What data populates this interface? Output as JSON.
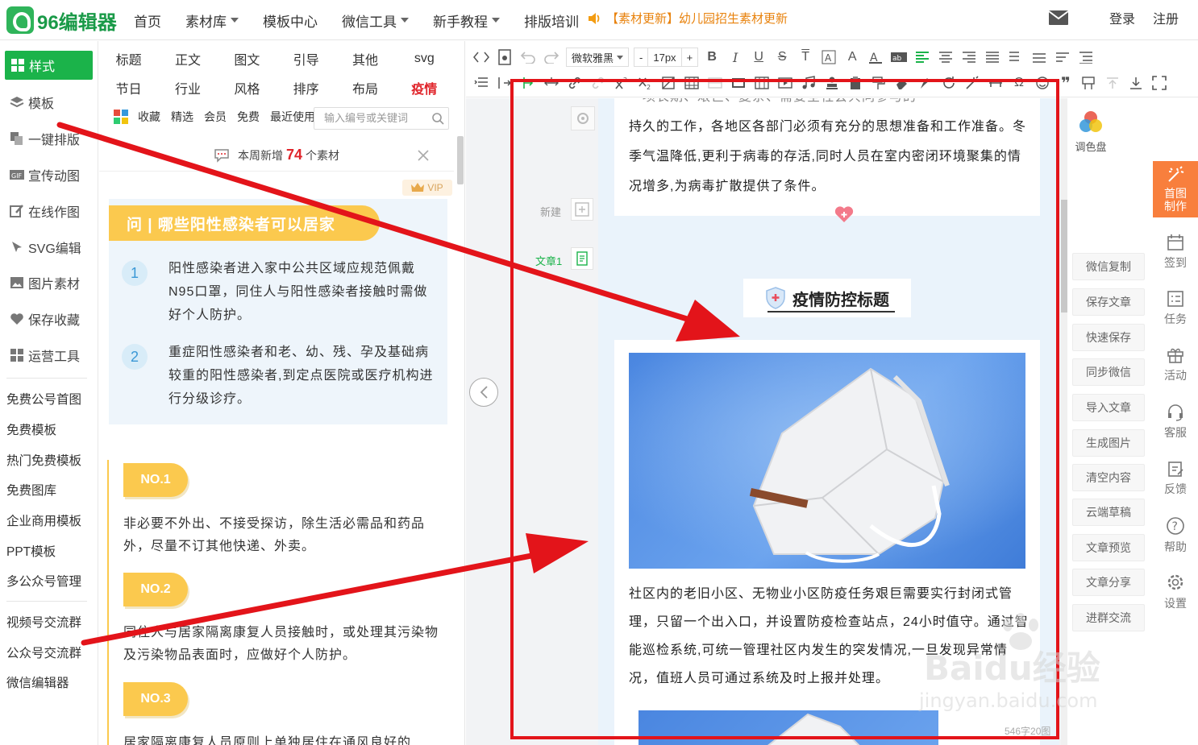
{
  "header": {
    "logo_text": "96编辑器",
    "nav": [
      {
        "label": "首页",
        "caret": false
      },
      {
        "label": "素材库",
        "caret": true
      },
      {
        "label": "模板中心",
        "caret": false
      },
      {
        "label": "微信工具",
        "caret": true
      },
      {
        "label": "新手教程",
        "caret": true
      },
      {
        "label": "排版培训",
        "caret": false
      }
    ],
    "notice": "【素材更新】幼儿园招生素材更新",
    "login": "登录",
    "register": "注册"
  },
  "sidebar": {
    "items": [
      "样式",
      "模板",
      "一键排版",
      "宣传动图",
      "在线作图",
      "SVG编辑",
      "图片素材",
      "保存收藏",
      "运营工具"
    ],
    "links": [
      "免费公号首图",
      "免费模板",
      "热门免费模板",
      "免费图库",
      "企业商用模板",
      "PPT模板",
      "多公众号管理"
    ],
    "links2": [
      "视频号交流群",
      "公众号交流群",
      "微信编辑器"
    ]
  },
  "panel": {
    "categories_row1": [
      "标题",
      "正文",
      "图文",
      "引导",
      "其他",
      "svg"
    ],
    "categories_row2": [
      "节日",
      "行业",
      "风格",
      "排序",
      "布局",
      "疫情"
    ],
    "filters": [
      "收藏",
      "精选",
      "会员",
      "免费",
      "最近使用"
    ],
    "search_placeholder": "输入编号或关键词",
    "weekly_prefix": "本周新增",
    "weekly_count": "74",
    "weekly_suffix": "个素材",
    "vip": "VIP",
    "card1": {
      "title": "问 | 哪些阳性感染者可以居家",
      "items": [
        {
          "num": "1",
          "text": "阳性感染者进入家中公共区域应规范佩戴N95口罩，同住人与阳性感染者接触时需做好个人防护。"
        },
        {
          "num": "2",
          "text": "重症阳性感染者和老、幼、残、孕及基础病较重的阳性感染者,到定点医院或医疗机构进行分级诊疗。"
        }
      ]
    },
    "card2": {
      "items": [
        {
          "tag": "NO.1",
          "text": "非必要不外出、不接受探访，除生活必需品和药品外，尽量不订其他快递、外卖。"
        },
        {
          "tag": "NO.2",
          "text": "同住人与居家隔离康复人员接触时，或处理其污染物及污染物品表面时，应做好个人防护。"
        },
        {
          "tag": "NO.3",
          "text": "居家隔离康复人员原则上单独居住在通风良好的"
        }
      ]
    }
  },
  "toolbar": {
    "font_family": "微软雅黑",
    "font_size": "17px",
    "minus": "-",
    "plus": "+"
  },
  "editor": {
    "side": {
      "new": "新建",
      "article": "文章1"
    },
    "para1": "持久的工作，各地区各部门必须有充分的思想准备和工作准备。冬季气温降低,更利于病毒的存活,同时人员在室内密闭环境聚集的情况增多,为病毒扩散提供了条件。",
    "para1_top": "一项长期、艰巨、复杂、需要全社会共同参与的",
    "banner": "疫情防控标题",
    "para2": "社区内的老旧小区、无物业小区防疫任务艰巨需要实行封闭式管理，只留一个出入口，并设置防疫检查站点，24小时值守。通过智能巡检系统,可统一管理社区内发生的突发情况,一旦发现异常情况，值班人员可通过系统及时上报并处理。",
    "wordcount": "546字20图"
  },
  "right": {
    "palette": "调色盘",
    "buttons": [
      "微信复制",
      "保存文章",
      "快速保存",
      "同步微信",
      "导入文章",
      "生成图片",
      "清空内容",
      "云端草稿",
      "文章预览",
      "文章分享",
      "进群交流"
    ],
    "rail": [
      "首图制作",
      "签到",
      "任务",
      "活动",
      "客服",
      "反馈",
      "帮助",
      "设置"
    ]
  },
  "watermark": {
    "brand": "Baidu经验",
    "url": "jingyan.baidu.com"
  },
  "colors": {
    "brand_green": "#1bb34a",
    "accent_orange": "#f87f3d",
    "annotation_red": "#e3141a",
    "card_yellow": "#fbc94e"
  }
}
